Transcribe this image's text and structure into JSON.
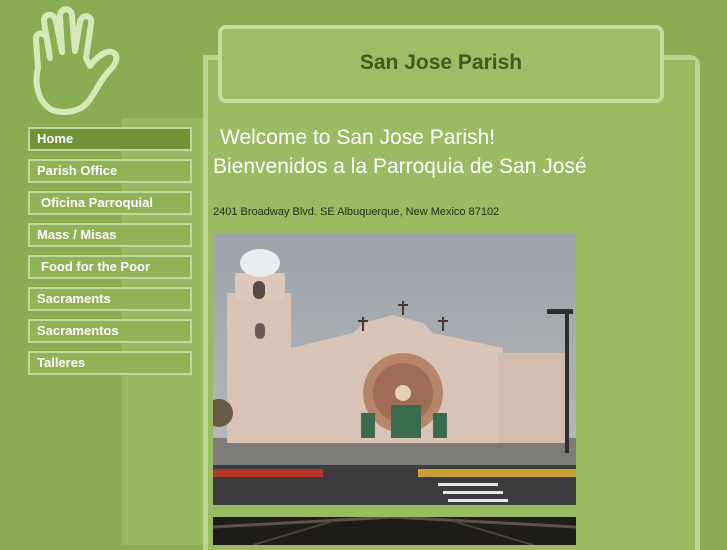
{
  "site": {
    "title": "San Jose Parish"
  },
  "nav": {
    "items": [
      {
        "label": "Home",
        "active": true
      },
      {
        "label": "Parish Office"
      },
      {
        "label": "Oficina Parroquial"
      },
      {
        "label": "Mass / Misas"
      },
      {
        "label": "Food for the Poor"
      },
      {
        "label": "Sacraments"
      },
      {
        "label": "Sacramentos"
      },
      {
        "label": "Talleres"
      }
    ]
  },
  "content": {
    "welcome_en": "Welcome to San Jose Parish!",
    "welcome_es": "Bienvenidos a la Parroquia de San José",
    "address": "2401 Broadway Blvd. SE Albuquerque, New Mexico 87102"
  },
  "colors": {
    "background": "#8aac52",
    "panel": "#9bbb63",
    "border": "#c2d99a",
    "title_text": "#3f5a1f",
    "nav_active": "#6f9336"
  }
}
